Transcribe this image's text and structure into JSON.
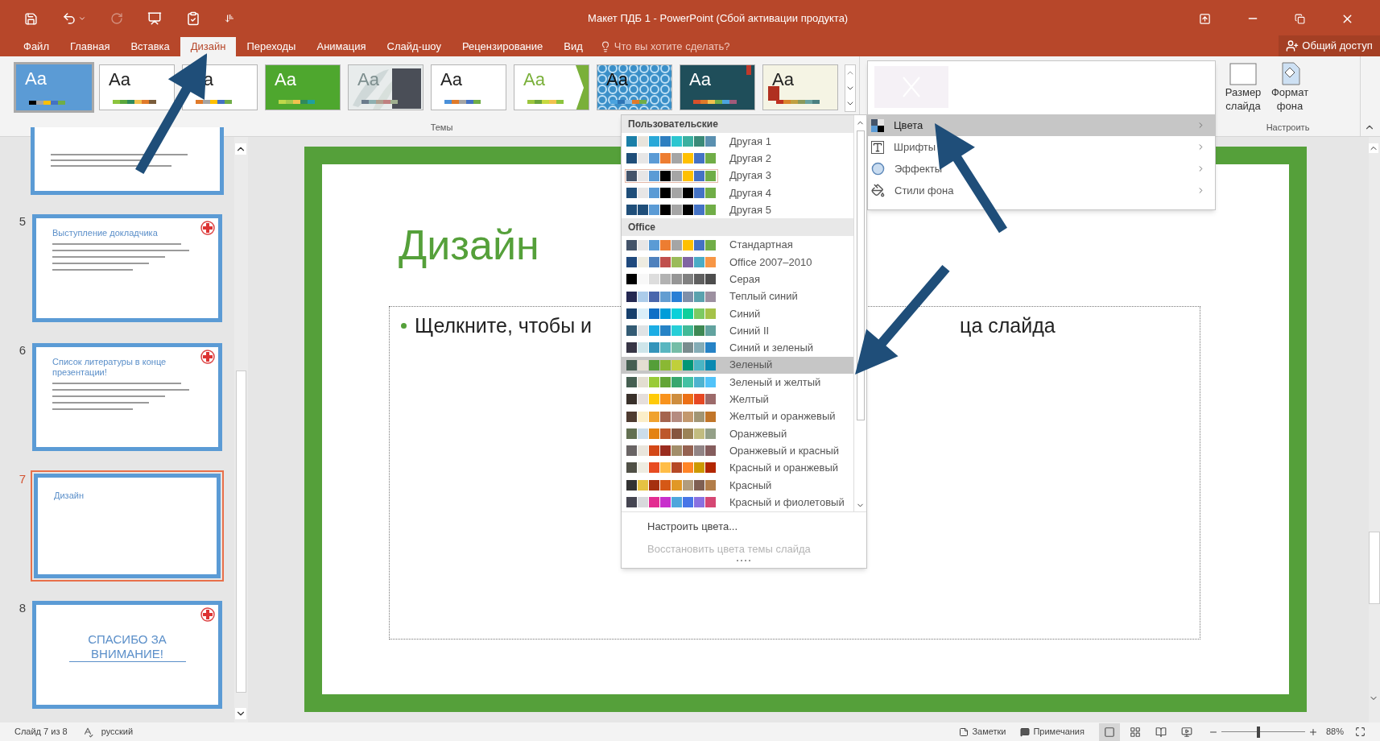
{
  "window": {
    "title": "Макет ПДБ 1 - PowerPoint (Сбой активации продукта)"
  },
  "tabs": [
    {
      "label": "Файл",
      "selected": false
    },
    {
      "label": "Главная",
      "selected": false
    },
    {
      "label": "Вставка",
      "selected": false
    },
    {
      "label": "Дизайн",
      "selected": true
    },
    {
      "label": "Переходы",
      "selected": false
    },
    {
      "label": "Анимация",
      "selected": false
    },
    {
      "label": "Слайд-шоу",
      "selected": false
    },
    {
      "label": "Рецензирование",
      "selected": false
    },
    {
      "label": "Вид",
      "selected": false
    }
  ],
  "tell_me": {
    "placeholder": "Что вы хотите сделать?"
  },
  "share": {
    "label": "Общий доступ"
  },
  "themes": {
    "group_label": "Темы",
    "items": [
      {
        "sample": "Aa",
        "kind": "dark",
        "selected": true,
        "color": "#5b9bd5",
        "swatches": [
          {
            "color": "#000000"
          },
          {
            "color": "#a5a5a5"
          },
          {
            "color": "#ffc000"
          },
          {
            "color": "#4472c4"
          },
          {
            "color": "#70ad47"
          }
        ]
      },
      {
        "sample": "Aa",
        "kind": "light",
        "selected": false,
        "color": "#ffffff",
        "swatches": [
          {
            "color": "#8cc43d"
          },
          {
            "color": "#5aa83c"
          },
          {
            "color": "#2f8a5b"
          },
          {
            "color": "#f2c14e"
          },
          {
            "color": "#e07a2a"
          },
          {
            "color": "#7a5c3a"
          }
        ]
      },
      {
        "sample": "a",
        "kind": "light",
        "selected": false,
        "color": "#ffffff",
        "swatches": [
          {
            "color": "#e07a2a"
          },
          {
            "color": "#a5a5a5"
          },
          {
            "color": "#ffc000"
          },
          {
            "color": "#4472c4"
          },
          {
            "color": "#70ad47"
          }
        ]
      },
      {
        "sample": "Aa",
        "kind": "dark",
        "selected": false,
        "color": "#4ea72e",
        "swatches": [
          {
            "color": "#c0d84a"
          },
          {
            "color": "#a4c94a"
          },
          {
            "color": "#f2c14e"
          },
          {
            "color": "#2f8a5b"
          },
          {
            "color": "#1f9fa0"
          }
        ]
      },
      {
        "sample": "Aa",
        "kind": "panel",
        "selected": false,
        "color": "#e8ecec",
        "swatches": [
          {
            "color": "#6b7b8c"
          },
          {
            "color": "#8fb0b0"
          },
          {
            "color": "#b0a090"
          },
          {
            "color": "#c08080"
          },
          {
            "color": "#a0b090"
          }
        ]
      },
      {
        "sample": "Aa",
        "kind": "light",
        "selected": false,
        "color": "#ffffff",
        "swatches": [
          {
            "color": "#4a90d9"
          },
          {
            "color": "#e07a2a"
          },
          {
            "color": "#a5a5a5"
          },
          {
            "color": "#4472c4"
          },
          {
            "color": "#70ad47"
          }
        ]
      },
      {
        "sample": "Aa",
        "kind": "chevron",
        "selected": false,
        "color": "#ffffff",
        "swatches": [
          {
            "color": "#9bc53d"
          },
          {
            "color": "#6aa33a"
          },
          {
            "color": "#c7d93f"
          },
          {
            "color": "#f2c14e"
          },
          {
            "color": "#8cc43d"
          }
        ]
      },
      {
        "sample": "Aa",
        "kind": "pattern",
        "selected": false,
        "color": "#3a8fc8",
        "swatches": [
          {
            "color": "#4aa3df"
          },
          {
            "color": "#2e75b6"
          },
          {
            "color": "#7fbbe8"
          },
          {
            "color": "#e07a2a"
          },
          {
            "color": "#70ad47"
          }
        ]
      },
      {
        "sample": "Aa",
        "kind": "banner",
        "selected": false,
        "color": "#1f4e5a",
        "swatches": [
          {
            "color": "#d9502a"
          },
          {
            "color": "#e07a2a"
          },
          {
            "color": "#f2c14e"
          },
          {
            "color": "#70ad47"
          },
          {
            "color": "#4aa3df"
          },
          {
            "color": "#a05a7a"
          }
        ]
      },
      {
        "sample": "Aa",
        "kind": "flag",
        "selected": false,
        "color": "#f5f4e4",
        "swatches": [
          {
            "color": "#c03020"
          },
          {
            "color": "#d9832a"
          },
          {
            "color": "#c0a040"
          },
          {
            "color": "#8a9a5b"
          },
          {
            "color": "#6aa3a0"
          },
          {
            "color": "#4a8080"
          }
        ]
      }
    ]
  },
  "variant_menu": [
    {
      "label": "Цвета",
      "kind": "colors",
      "selected": true
    },
    {
      "label": "Шрифты",
      "kind": "fonts",
      "selected": false
    },
    {
      "label": "Эффекты",
      "kind": "effects",
      "selected": false
    },
    {
      "label": "Стили фона",
      "kind": "background",
      "selected": false
    }
  ],
  "customize": {
    "group_label": "Настроить",
    "buttons": [
      {
        "label": "Размер слайда",
        "kind": "size"
      },
      {
        "label": "Формат фона",
        "kind": "format"
      }
    ]
  },
  "color_menu": {
    "sections": [
      {
        "heading": "Пользовательские",
        "items": [
          {
            "label": "Другая 1",
            "selected": false,
            "current": false,
            "swatches": [
              {
                "color": "#1a7fa8"
              },
              {
                "color": "#e8e4dc"
              },
              {
                "color": "#29a8d8"
              },
              {
                "color": "#2e7fc0"
              },
              {
                "color": "#2cc6d0"
              },
              {
                "color": "#3ab0a0"
              },
              {
                "color": "#3a8a78"
              },
              {
                "color": "#5a90b0"
              }
            ]
          },
          {
            "label": "Другая 2",
            "selected": false,
            "current": false,
            "swatches": [
              {
                "color": "#1f4e79"
              },
              {
                "color": "#e7e6e6"
              },
              {
                "color": "#5b9bd5"
              },
              {
                "color": "#ed7d31"
              },
              {
                "color": "#a5a5a5"
              },
              {
                "color": "#ffc000"
              },
              {
                "color": "#4472c4"
              },
              {
                "color": "#70ad47"
              }
            ]
          },
          {
            "label": "Другая 3",
            "selected": false,
            "current": true,
            "swatches": [
              {
                "color": "#44546a"
              },
              {
                "color": "#e7e6e6"
              },
              {
                "color": "#5b9bd5"
              },
              {
                "color": "#000000"
              },
              {
                "color": "#a5a5a5"
              },
              {
                "color": "#ffc000"
              },
              {
                "color": "#4472c4"
              },
              {
                "color": "#70ad47"
              }
            ]
          },
          {
            "label": "Другая 4",
            "selected": false,
            "current": false,
            "swatches": [
              {
                "color": "#1f4e79"
              },
              {
                "color": "#e7e6e6"
              },
              {
                "color": "#5b9bd5"
              },
              {
                "color": "#000000"
              },
              {
                "color": "#a5a5a5"
              },
              {
                "color": "#000000"
              },
              {
                "color": "#4472c4"
              },
              {
                "color": "#70ad47"
              }
            ]
          },
          {
            "label": "Другая 5",
            "selected": false,
            "current": false,
            "swatches": [
              {
                "color": "#1f4e79"
              },
              {
                "color": "#1f4e79"
              },
              {
                "color": "#5b9bd5"
              },
              {
                "color": "#000000"
              },
              {
                "color": "#a5a5a5"
              },
              {
                "color": "#000000"
              },
              {
                "color": "#4472c4"
              },
              {
                "color": "#70ad47"
              }
            ]
          }
        ]
      },
      {
        "heading": "Office",
        "items": [
          {
            "label": "Стандартная",
            "selected": false,
            "current": false,
            "swatches": [
              {
                "color": "#44546a"
              },
              {
                "color": "#e7e6e6"
              },
              {
                "color": "#5b9bd5"
              },
              {
                "color": "#ed7d31"
              },
              {
                "color": "#a5a5a5"
              },
              {
                "color": "#ffc000"
              },
              {
                "color": "#4472c4"
              },
              {
                "color": "#70ad47"
              }
            ]
          },
          {
            "label": "Office 2007–2010",
            "selected": false,
            "current": false,
            "swatches": [
              {
                "color": "#1f497d"
              },
              {
                "color": "#eeece1"
              },
              {
                "color": "#4f81bd"
              },
              {
                "color": "#c0504d"
              },
              {
                "color": "#9bbb59"
              },
              {
                "color": "#8064a2"
              },
              {
                "color": "#4bacc6"
              },
              {
                "color": "#f79646"
              }
            ]
          },
          {
            "label": "Серая",
            "selected": false,
            "current": false,
            "swatches": [
              {
                "color": "#000000"
              },
              {
                "color": "#f8f8f8"
              },
              {
                "color": "#dddddd"
              },
              {
                "color": "#b2b2b2"
              },
              {
                "color": "#969696"
              },
              {
                "color": "#808080"
              },
              {
                "color": "#5f5f5f"
              },
              {
                "color": "#4d4d4d"
              }
            ]
          },
          {
            "label": "Теплый синий",
            "selected": false,
            "current": false,
            "swatches": [
              {
                "color": "#242852"
              },
              {
                "color": "#acccea"
              },
              {
                "color": "#4a66ac"
              },
              {
                "color": "#629dd1"
              },
              {
                "color": "#297fd5"
              },
              {
                "color": "#7f8fa9"
              },
              {
                "color": "#5aa2ae"
              },
              {
                "color": "#9d90a0"
              }
            ]
          },
          {
            "label": "Синий",
            "selected": false,
            "current": false,
            "swatches": [
              {
                "color": "#17406d"
              },
              {
                "color": "#dbeff9"
              },
              {
                "color": "#0f6fc6"
              },
              {
                "color": "#009dd9"
              },
              {
                "color": "#0bd0d9"
              },
              {
                "color": "#10cf9b"
              },
              {
                "color": "#7cca62"
              },
              {
                "color": "#a5c249"
              }
            ]
          },
          {
            "label": "Синий II",
            "selected": false,
            "current": false,
            "swatches": [
              {
                "color": "#335b74"
              },
              {
                "color": "#dfe3e5"
              },
              {
                "color": "#1cade4"
              },
              {
                "color": "#2683c6"
              },
              {
                "color": "#27ced7"
              },
              {
                "color": "#42ba97"
              },
              {
                "color": "#3e8853"
              },
              {
                "color": "#62a39f"
              }
            ]
          },
          {
            "label": "Синий и зеленый",
            "selected": false,
            "current": false,
            "swatches": [
              {
                "color": "#373545"
              },
              {
                "color": "#cee5ea"
              },
              {
                "color": "#3494ba"
              },
              {
                "color": "#58b6c0"
              },
              {
                "color": "#75bda7"
              },
              {
                "color": "#7a8c8e"
              },
              {
                "color": "#84acb6"
              },
              {
                "color": "#2683c6"
              }
            ]
          },
          {
            "label": "Зеленый",
            "selected": true,
            "current": false,
            "swatches": [
              {
                "color": "#455f51"
              },
              {
                "color": "#e3ded1"
              },
              {
                "color": "#549e39"
              },
              {
                "color": "#8ab833"
              },
              {
                "color": "#c0cf3a"
              },
              {
                "color": "#029676"
              },
              {
                "color": "#4ab5c4"
              },
              {
                "color": "#0989b1"
              }
            ]
          },
          {
            "label": "Зеленый и желтый",
            "selected": false,
            "current": false,
            "swatches": [
              {
                "color": "#455f51"
              },
              {
                "color": "#e3ded1"
              },
              {
                "color": "#99cb38"
              },
              {
                "color": "#63a537"
              },
              {
                "color": "#37a76f"
              },
              {
                "color": "#44c1a3"
              },
              {
                "color": "#4eb3cf"
              },
              {
                "color": "#51c3f9"
              }
            ]
          },
          {
            "label": "Желтый",
            "selected": false,
            "current": false,
            "swatches": [
              {
                "color": "#39302a"
              },
              {
                "color": "#e5dedb"
              },
              {
                "color": "#ffca08"
              },
              {
                "color": "#f8931d"
              },
              {
                "color": "#ce8d3e"
              },
              {
                "color": "#ec7016"
              },
              {
                "color": "#e64823"
              },
              {
                "color": "#9c6a6a"
              }
            ]
          },
          {
            "label": "Желтый и оранжевый",
            "selected": false,
            "current": false,
            "swatches": [
              {
                "color": "#4e3b30"
              },
              {
                "color": "#fbeec9"
              },
              {
                "color": "#f0a22e"
              },
              {
                "color": "#a5644e"
              },
              {
                "color": "#b58b80"
              },
              {
                "color": "#c3986d"
              },
              {
                "color": "#a19574"
              },
              {
                "color": "#c17529"
              }
            ]
          },
          {
            "label": "Оранжевый",
            "selected": false,
            "current": false,
            "swatches": [
              {
                "color": "#637052"
              },
              {
                "color": "#ccddea"
              },
              {
                "color": "#e48312"
              },
              {
                "color": "#bd582c"
              },
              {
                "color": "#865640"
              },
              {
                "color": "#9b8357"
              },
              {
                "color": "#c2bc80"
              },
              {
                "color": "#94a088"
              }
            ]
          },
          {
            "label": "Оранжевый и красный",
            "selected": false,
            "current": false,
            "swatches": [
              {
                "color": "#696464"
              },
              {
                "color": "#e9e5dc"
              },
              {
                "color": "#d34817"
              },
              {
                "color": "#9b2d1f"
              },
              {
                "color": "#a28e6a"
              },
              {
                "color": "#956251"
              },
              {
                "color": "#918485"
              },
              {
                "color": "#855d5d"
              }
            ]
          },
          {
            "label": "Красный и оранжевый",
            "selected": false,
            "current": false,
            "swatches": [
              {
                "color": "#505046"
              },
              {
                "color": "#eeece1"
              },
              {
                "color": "#e84c22"
              },
              {
                "color": "#ffbd47"
              },
              {
                "color": "#b64926"
              },
              {
                "color": "#ff8427"
              },
              {
                "color": "#cc9900"
              },
              {
                "color": "#b22600"
              }
            ]
          },
          {
            "label": "Красный",
            "selected": false,
            "current": false,
            "swatches": [
              {
                "color": "#323232"
              },
              {
                "color": "#e5c243"
              },
              {
                "color": "#a5300f"
              },
              {
                "color": "#d55816"
              },
              {
                "color": "#e19825"
              },
              {
                "color": "#b19c7d"
              },
              {
                "color": "#7f5f52"
              },
              {
                "color": "#b27d49"
              }
            ]
          },
          {
            "label": "Красный и фиолетовый",
            "selected": false,
            "current": false,
            "swatches": [
              {
                "color": "#454551"
              },
              {
                "color": "#d8d9dc"
              },
              {
                "color": "#e32d91"
              },
              {
                "color": "#c830cc"
              },
              {
                "color": "#4ea6dc"
              },
              {
                "color": "#4775e7"
              },
              {
                "color": "#8971e1"
              },
              {
                "color": "#d54773"
              }
            ]
          }
        ]
      }
    ],
    "actions": [
      {
        "label": "Настроить цвета...",
        "disabled": false
      },
      {
        "label": "Восстановить цвета темы слайда",
        "disabled": true
      }
    ]
  },
  "slides": [
    {
      "kind": "cropped",
      "selected": false
    },
    {
      "number": "5",
      "kind": "bullets",
      "title": "Выступление докладчика",
      "selected": false,
      "has_logo": true
    },
    {
      "number": "6",
      "kind": "bullets",
      "title": "Список литературы в конце презентации!",
      "selected": false,
      "has_logo": true
    },
    {
      "number": "7",
      "kind": "title",
      "title": "Дизайн",
      "selected": true,
      "has_logo": false
    },
    {
      "number": "8",
      "kind": "closing",
      "title": "СПАСИБО ЗА ВНИМАНИЕ!",
      "selected": false,
      "has_logo": true
    }
  ],
  "slide": {
    "title": "Дизайн",
    "body_parts": [
      "Щелкните, чтобы и",
      "ца слайда"
    ]
  },
  "status_bar": {
    "slide_info": "Слайд 7 из 8",
    "language": "русский",
    "notes": "Заметки",
    "comments": "Примечания",
    "views": [
      {
        "kind": "normal",
        "selected": true
      },
      {
        "kind": "sorter",
        "selected": false
      },
      {
        "kind": "reading",
        "selected": false
      },
      {
        "kind": "slideshow",
        "selected": false
      }
    ],
    "zoom": {
      "level": 0.44,
      "reading": "88%"
    }
  }
}
